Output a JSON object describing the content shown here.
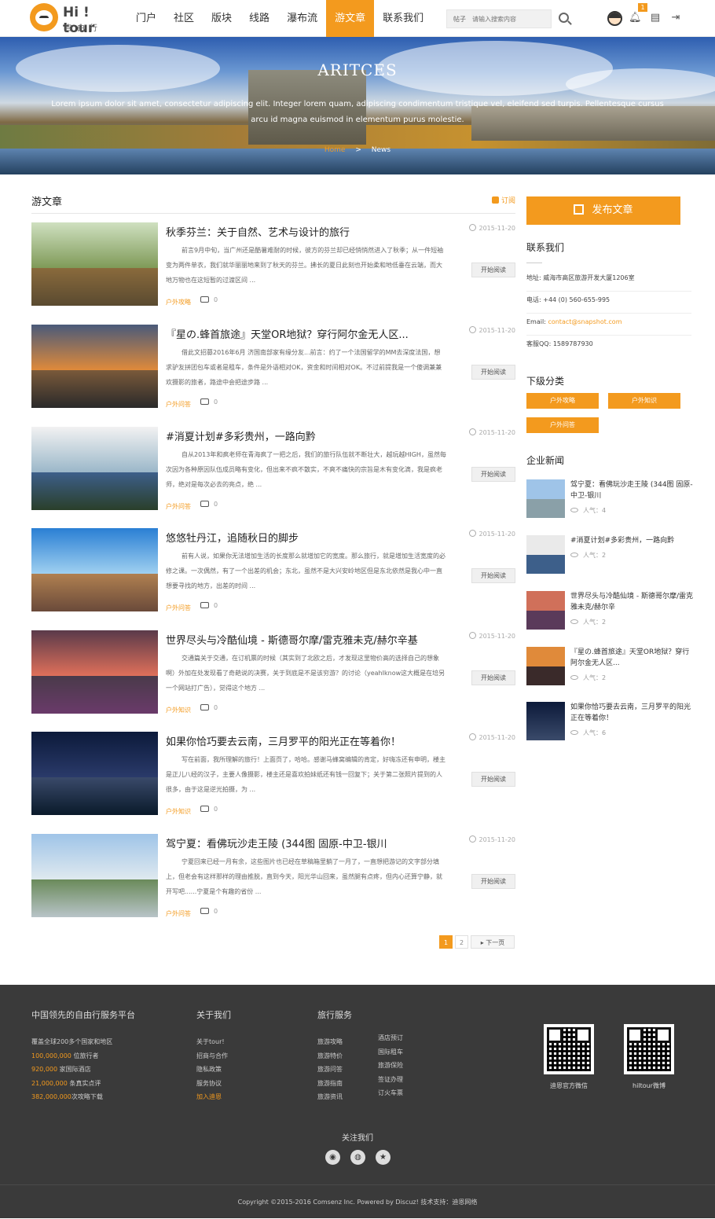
{
  "header": {
    "logo_title": "Hi ! tour",
    "logo_sub": "自由行",
    "nav": [
      "门户",
      "社区",
      "版块",
      "线路",
      "瀑布流",
      "游文章",
      "联系我们"
    ],
    "active_nav": "游文章",
    "search_type": "帖子",
    "search_placeholder": "请输入搜索内容",
    "notification_count": "1"
  },
  "banner": {
    "title": "ARITCES",
    "desc": "Lorem ipsum dolor sit amet, consectetur adipiscing elit. Integer lorem quam, adipiscing condimentum tristique vel, eleifend sed turpis. Pellentesque cursus arcu id magna euismod in elementum purus molestie.",
    "crumb_home": "Home",
    "crumb_sep": ">",
    "crumb_current": "News"
  },
  "main": {
    "title": "游文章",
    "subscribe": "订阅",
    "read_label": "开始阅读",
    "articles": [
      {
        "title": "秋季芬兰：关于自然、艺术与设计的旅行",
        "date": "2015-11-20",
        "excerpt": "前言9月中旬，当广州还是酷暑难耐的时候，彼方的芬兰却已经悄悄然进入了秋季；从一件短袖变为两件单衣，我们就华丽丽地来到了秋天的芬兰。拂长的夏日此刻也开始柔和地低垂在云端，而大地万物也在这短暂的过渡区间 ...",
        "category": "户外攻略",
        "comments": "0"
      },
      {
        "title": "『星の.蜂首旅途』天堂OR地狱？穿行阿尔金无人区...",
        "date": "2015-11-20",
        "excerpt": "借此文招募2016年6月 济国南部家有缘分友...前言：约了一个法国留学的MM去深度法国，想求驴友拼团包车或者是租车，条件是外语相对OK，资金和时间相对OK。不过前提我是一个傻调兼兼欢摄影的旅者，路途中会把途步路 ...",
        "category": "户外问答",
        "comments": "0"
      },
      {
        "title": "#消夏计划#多彩贵州，一路向黔",
        "date": "2015-11-20",
        "excerpt": "自从2013年和疯老师在青海疯了一把之后，我们的旅行队伍就不断壮大，越玩越HIGH，虽然每次因为各种原因队伍成员略有变化，但出来不疯不散实，不爽不痛快的宗旨是木有变化滴，我是疯老师，绝对是每次必去的亮点，绝 ...",
        "category": "户外问答",
        "comments": "0"
      },
      {
        "title": "悠悠牡丹江，追随秋日的脚步",
        "date": "2015-11-20",
        "excerpt": "前有人说，如果你无法增加生活的长度那么就增加它的宽度。那么旅行，就是增加生活宽度的必修之课。一次偶然，有了一个出差的机会；东北，虽然不是大兴安岭地区但是东北依然是我心中一直想要寻找的地方，出差的时间 ...",
        "category": "户外问答",
        "comments": "0"
      },
      {
        "title": "世界尽头与冷酷仙境 - 斯德哥尔摩/雷克雅未克/赫尔辛基",
        "date": "2015-11-20",
        "excerpt": "交通篇关于交通，在订机票的时候（其实到了北欧之后，才发现这里物价高的选择自己的想象啊）外加在处发现看了奇葩说的决赛，关于到底是不是该穷游？的讨论（yeahIknow这大概是在培另一个网站打广告），觉得这个地方 ...",
        "category": "户外知识",
        "comments": "0"
      },
      {
        "title": "如果你恰巧要去云南，三月罗平的阳光正在等着你！",
        "date": "2015-11-20",
        "excerpt": "写在前面，我所理解的旅行！上面页了，哈哈。感谢马蜂窝编辑的肯定，好嗨冻还有申明，楼主是正儿八经的汉子，主要人像摄影，楼主还是喜欢拍妹纸还有钱一回复下；关于第二张照片提到的人很多，由于这是逆光拍摄，为 ...",
        "category": "户外知识",
        "comments": "0"
      },
      {
        "title": "驾宁夏：看佛玩沙走王陵 (344图 固原-中卫-银川",
        "date": "2015-11-20",
        "excerpt": "宁夏回来已经一月有余，这些图片也已经在草稿箱里躺了一月了，一直想把游记的文字部分填上，但老会有这样那样的理由推脱，直到今天，阳光华山回来，虽然腿有点疼，但内心还算宁静，就开写吧......宁夏是个有趣的省份 ...",
        "category": "户外问答",
        "comments": "0"
      }
    ],
    "pages": [
      "1",
      "2"
    ],
    "next_label": "下一页"
  },
  "sidebar": {
    "publish": "发布文章",
    "contact_title": "联系我们",
    "address": "地址: 威海市高区旅游开发大厦1206室",
    "phone": "电话: +44 (0) 560-655-995",
    "email_label": "Email: ",
    "email": "contact@snapshot.com",
    "qq": "客服QQ: 1589787930",
    "sub_title": "下级分类",
    "categories": [
      "户外攻略",
      "户外知识",
      "户外问答"
    ],
    "news_title": "企业新闻",
    "news": [
      {
        "title": "驾宁夏：看佛玩沙走王陵 (344图 固原-中卫-银川",
        "views": "人气：4"
      },
      {
        "title": "#消夏计划#多彩贵州，一路向黔",
        "views": "人气：2"
      },
      {
        "title": "世界尽头与冷酷仙境 - 斯德哥尔摩/雷克雅未克/赫尔辛",
        "views": "人气：2"
      },
      {
        "title": "『星の.蜂首旅途』天堂OR地狱？穿行阿尔金无人区...",
        "views": "人气：2"
      },
      {
        "title": "如果你恰巧要去云南，三月罗平的阳光正在等着你！",
        "views": "人气：6"
      }
    ]
  },
  "footer": {
    "col1": {
      "title": "中国领先的自由行服务平台",
      "line1": "覆盖全球200多个国家和地区",
      "stats": [
        {
          "num": "100,000,000",
          "label": " 位旅行者"
        },
        {
          "num": "920,000",
          "label": " 家国际酒店"
        },
        {
          "num": "21,000,000",
          "label": " 条真实点评"
        },
        {
          "num": "382,000,000",
          "label": "次攻略下载"
        }
      ]
    },
    "col2": {
      "title": "关于我们",
      "links": [
        "关于tour!",
        "招商与合作",
        "隐私政策",
        "服务协议"
      ],
      "highlight": "加入迪恩"
    },
    "col3": {
      "title": "旅行服务",
      "links_a": [
        "旅游攻略",
        "旅游特价",
        "旅游问答",
        "旅游指南",
        "旅游资讯"
      ],
      "links_b": [
        "酒店预订",
        "国际租车",
        "旅游保险",
        "签证办理",
        "订火车票"
      ]
    },
    "qr1_label": "迪恩官方微信",
    "qr2_label": "hiltour微博",
    "follow": "关注我们",
    "copyright": "Copyright ©2015-2016 Comsenz Inc. Powered by Discuz! 技术支持：迪恩网络"
  },
  "icons": [
    "logo-icon",
    "search-icon",
    "avatar",
    "bell-icon",
    "clipboard-icon",
    "logout-icon",
    "rss-icon",
    "clock-icon",
    "comment-icon",
    "edit-icon",
    "eye-icon",
    "weibo-icon",
    "wechat-icon",
    "star-icon"
  ],
  "colors": {
    "accent": "#f39a1e",
    "footer_bg": "#3a3a3a"
  }
}
